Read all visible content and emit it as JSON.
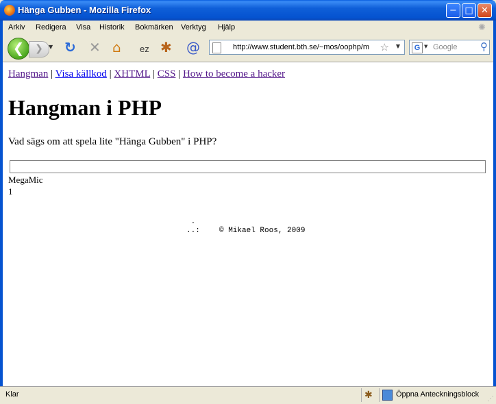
{
  "window": {
    "title": "Hänga Gubben - Mozilla Firefox",
    "minimize_glyph": "−",
    "maximize_glyph": "□",
    "close_glyph": "✕"
  },
  "menu": [
    "Arkiv",
    "Redigera",
    "Visa",
    "Historik",
    "Bokmärken",
    "Verktyg",
    "Hjälp"
  ],
  "toolbar": {
    "back_glyph": "❮",
    "forward_glyph": "❯",
    "reload_glyph": "↻",
    "stop_glyph": "✕",
    "home_glyph": "⌂",
    "url": "http://www.student.bth.se/~mos/oophp/m",
    "search_placeholder": "Google",
    "search_engine_letter": "G",
    "icons": [
      "back-icon",
      "forward-icon",
      "reload-icon",
      "stop-icon",
      "home-icon",
      "extension-icon",
      "bug-icon",
      "snail-icon",
      "page-icon",
      "star-icon",
      "search-icon"
    ]
  },
  "page": {
    "links": [
      "Hangman",
      "Visa källkod",
      "XHTML",
      "CSS",
      "How to become a hacker"
    ],
    "separator": " | ",
    "heading": "Hangman i PHP",
    "intro": "Vad sägs om att spela lite \"Hänga Gubben\" i PHP?",
    "guess_value": "",
    "label_user": "MegaMic",
    "label_count": "1",
    "footer_ascii": " .\n..:",
    "footer_copyright": "© Mikael Roos, 2009"
  },
  "status": {
    "text": "Klar",
    "notes": "Öppna Anteckningsblock"
  },
  "colors": {
    "titlebar": "#0553d0",
    "visited_link": "#551a8b",
    "link": "#0000ee"
  }
}
